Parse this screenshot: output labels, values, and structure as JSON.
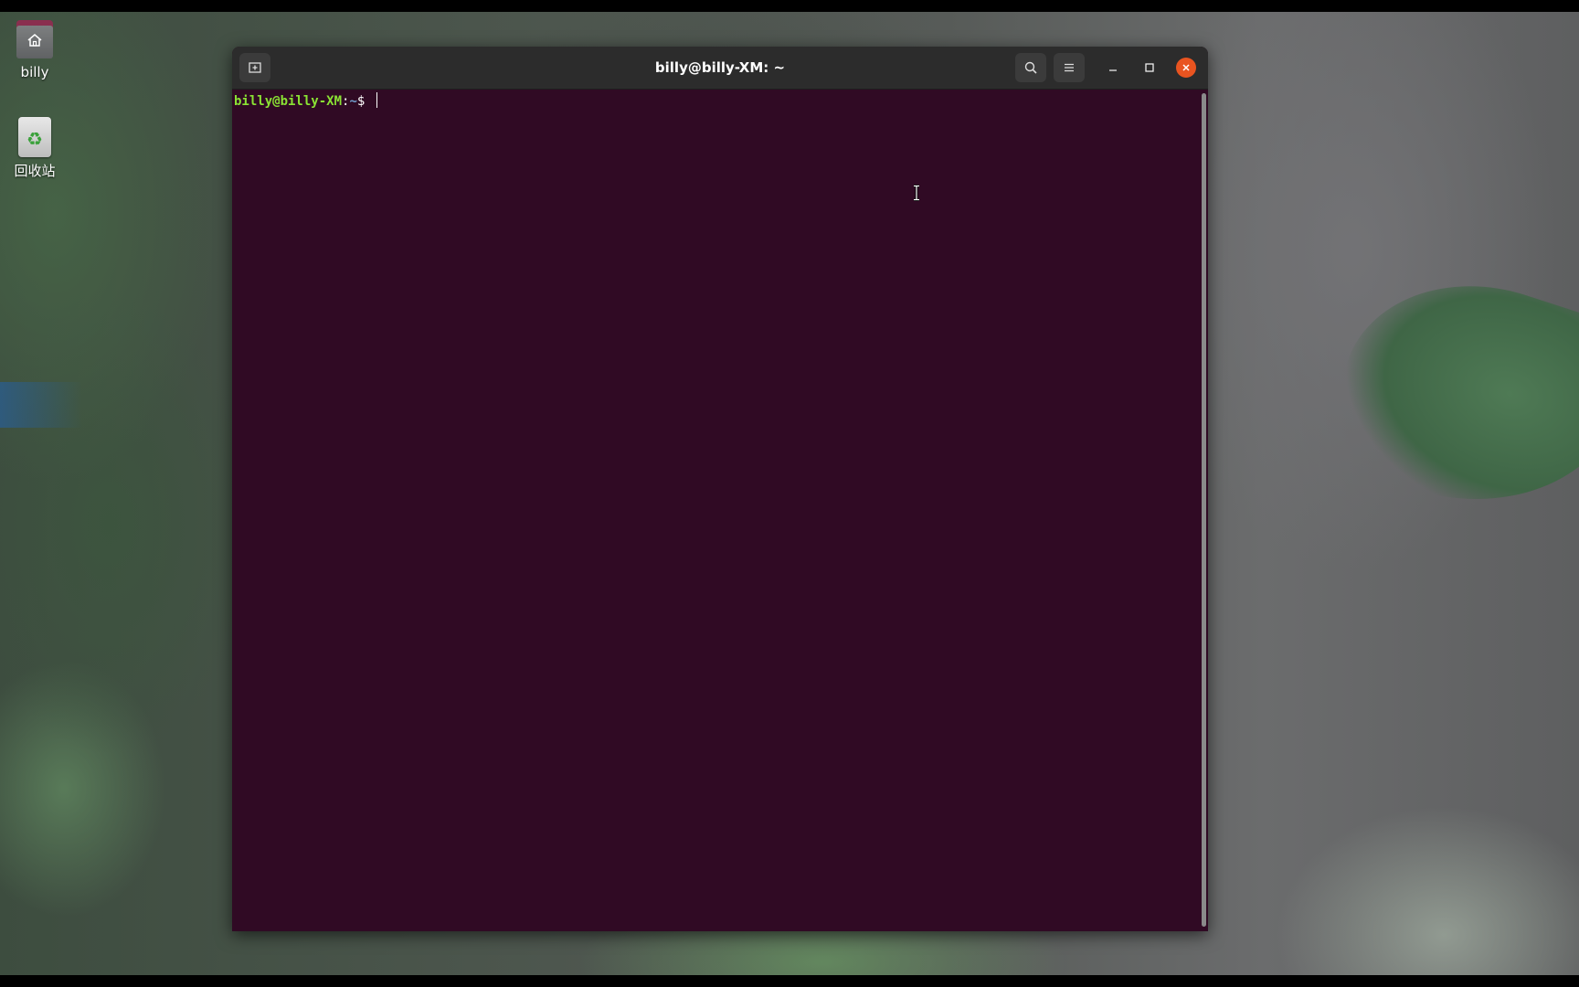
{
  "desktop": {
    "icons": [
      {
        "label": "billy",
        "icon": "home-folder-icon"
      },
      {
        "label": "回收站",
        "icon": "trash-icon"
      }
    ]
  },
  "terminal": {
    "title": "billy@billy-XM: ~",
    "prompt": {
      "user_host": "billy@billy-XM",
      "colon": ":",
      "dir": "~",
      "sign": "$ "
    },
    "buttons": {
      "new_tab": "new-tab-icon",
      "search": "search-icon",
      "menu": "hamburger-menu-icon",
      "minimize": "minimize-icon",
      "maximize": "maximize-icon",
      "close": "close-icon"
    },
    "colors": {
      "background": "#300a24",
      "titlebar": "#2c2c2c",
      "prompt_user": "#8ae234",
      "prompt_dir": "#729fcf",
      "close_button": "#e95420"
    }
  }
}
